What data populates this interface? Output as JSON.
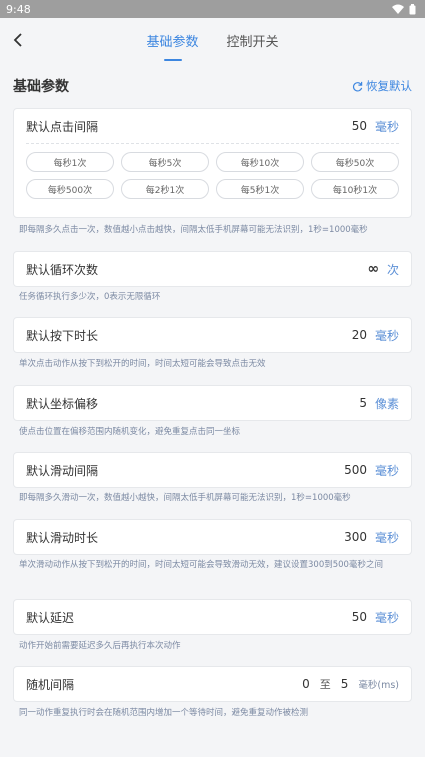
{
  "status": {
    "time": "9:48"
  },
  "tabs": [
    {
      "label": "基础参数"
    },
    {
      "label": "控制开关"
    }
  ],
  "section": {
    "title": "基础参数",
    "reset_label": "恢复默认"
  },
  "click_interval": {
    "label": "默认点击间隔",
    "value": "50",
    "unit": "毫秒",
    "presets": [
      "每秒1次",
      "每秒5次",
      "每秒10次",
      "每秒50次",
      "每秒500次",
      "每2秒1次",
      "每5秒1次",
      "每10秒1次"
    ],
    "desc": "即每隔多久点击一次，数值越小点击越快，间隔太低手机屏幕可能无法识别，1秒=1000毫秒"
  },
  "loop_count": {
    "label": "默认循环次数",
    "value": "∞",
    "unit": "次",
    "desc": "任务循环执行多少次，0表示无限循环"
  },
  "press_duration": {
    "label": "默认按下时长",
    "value": "20",
    "unit": "毫秒",
    "desc": "单次点击动作从按下到松开的时间，时间太短可能会导致点击无效"
  },
  "coord_offset": {
    "label": "默认坐标偏移",
    "value": "5",
    "unit": "像素",
    "desc": "使点击位置在偏移范围内随机变化，避免重复点击同一坐标"
  },
  "swipe_interval": {
    "label": "默认滑动间隔",
    "value": "500",
    "unit": "毫秒",
    "desc": "即每隔多久滑动一次，数值越小越快，间隔太低手机屏幕可能无法识别，1秒=1000毫秒"
  },
  "swipe_duration": {
    "label": "默认滑动时长",
    "value": "300",
    "unit": "毫秒",
    "desc": "单次滑动动作从按下到松开的时间，时间太短可能会导致滑动无效，建议设置300到500毫秒之间"
  },
  "delay": {
    "label": "默认延迟",
    "value": "50",
    "unit": "毫秒",
    "desc": "动作开始前需要延迟多久后再执行本次动作"
  },
  "random_interval": {
    "label": "随机间隔",
    "min": "0",
    "sep": "至",
    "max": "5",
    "unit": "毫秒(ms)",
    "desc": "同一动作重复执行时会在随机范围内增加一个等待时间，避免重复动作被检测"
  },
  "colors": {
    "accent": "#3c86e0",
    "background": "#f4f5f7",
    "statusbar": "#9e9e9e"
  }
}
